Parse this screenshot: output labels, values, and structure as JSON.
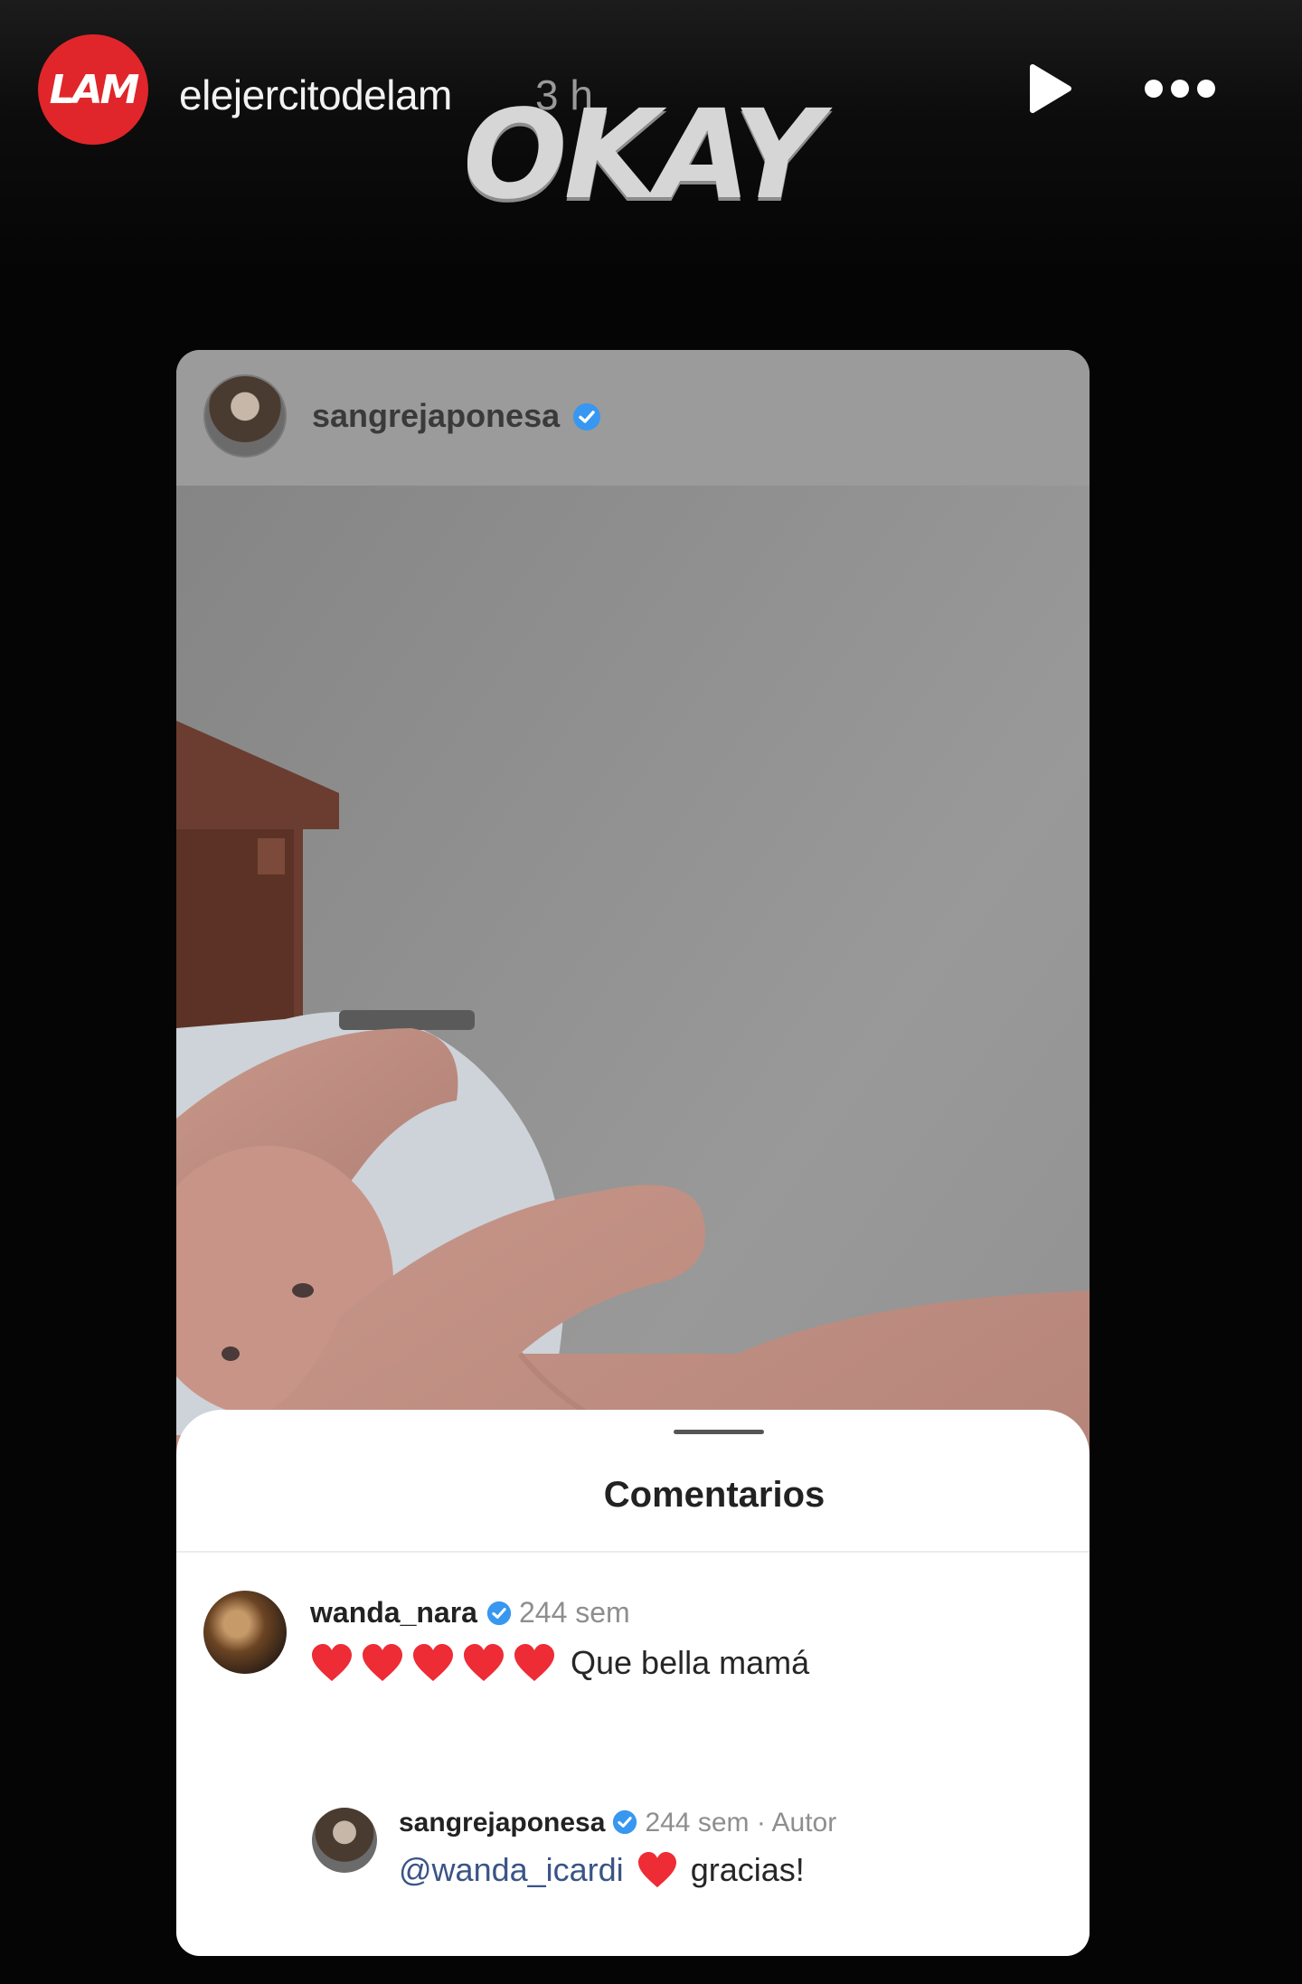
{
  "story": {
    "account_avatar_text": "LAM",
    "account_name": "elejercitodelam",
    "time": "3 h",
    "sticker_text": "OKAY",
    "play_icon": "play-icon",
    "more_icon": "more-horizontal-icon"
  },
  "post": {
    "username": "sangrejaponesa",
    "verified_icon": "verified-badge-icon"
  },
  "comments_sheet": {
    "title": "Comentarios",
    "comments": [
      {
        "username": "wanda_nara",
        "meta": "244 sem",
        "hearts": 5,
        "text": "Que bella mamá"
      },
      {
        "username": "sangrejaponesa",
        "meta": "244 sem · Autor",
        "mention": "@wanda_icardi",
        "text": "gracias!"
      }
    ]
  },
  "colors": {
    "brand_red": "#e0262b",
    "verified_blue": "#3897f0",
    "heart_red": "#ed2c36"
  }
}
